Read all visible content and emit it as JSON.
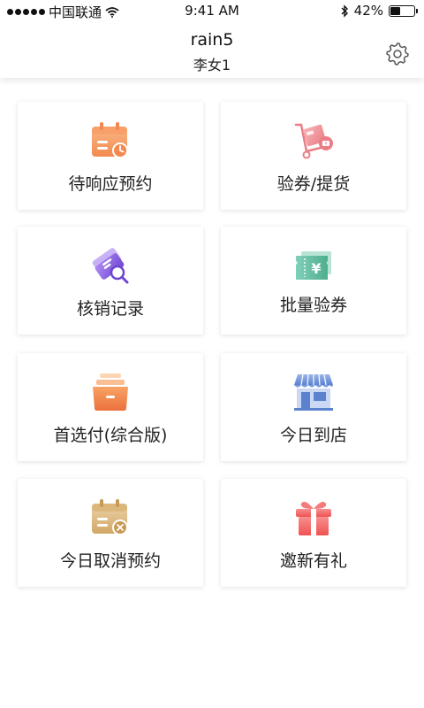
{
  "status_bar": {
    "carrier": "中国联通",
    "time": "9:41 AM",
    "battery": "42%",
    "battery_level": 0.42,
    "icons": [
      "signal-dots-icon",
      "wifi-icon",
      "bluetooth-icon",
      "battery-icon"
    ]
  },
  "header": {
    "title": "rain5",
    "subtitle": "李女1",
    "settings_icon": "gear-icon"
  },
  "menu": {
    "items": [
      {
        "label": "待响应预约",
        "icon": "calendar-clock-icon"
      },
      {
        "label": "验券/提货",
        "icon": "delivery-cart-icon"
      },
      {
        "label": "核销记录",
        "icon": "ticket-search-icon"
      },
      {
        "label": "批量验券",
        "icon": "yuan-ticket-icon"
      },
      {
        "label": "首选付(综合版)",
        "icon": "storage-box-icon"
      },
      {
        "label": "今日到店",
        "icon": "storefront-icon"
      },
      {
        "label": "今日取消预约",
        "icon": "calendar-cancel-icon"
      },
      {
        "label": "邀新有礼",
        "icon": "gift-icon"
      }
    ]
  },
  "colors": {
    "orange": "#f5a06b",
    "pink": "#f08e94",
    "purple": "#8a63e0",
    "teal": "#5fbfa3",
    "blue": "#6f93d6",
    "gold": "#d9b27a",
    "red": "#f36c6c"
  }
}
